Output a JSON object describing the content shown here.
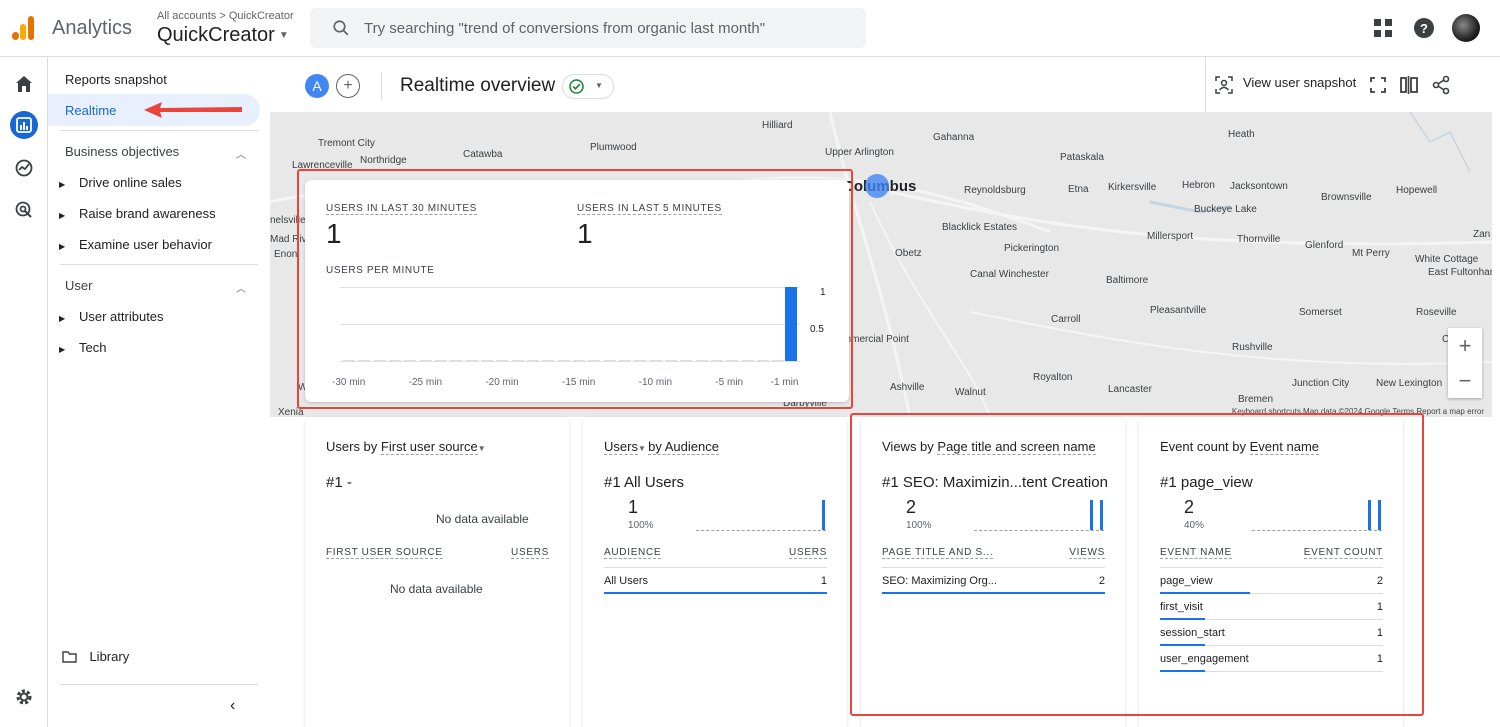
{
  "app": {
    "name": "Analytics",
    "crumb": "All accounts > QuickCreator",
    "property": "QuickCreator"
  },
  "search": {
    "placeholder": "Try searching \"trend of conversions from organic last month\""
  },
  "nav": {
    "reports_snapshot": "Reports snapshot",
    "realtime": "Realtime",
    "business_objectives": "Business objectives",
    "bo_items": [
      "Drive online sales",
      "Raise brand awareness",
      "Examine user behavior"
    ],
    "user_section": "User",
    "user_items": [
      "User attributes",
      "Tech"
    ],
    "library": "Library"
  },
  "header": {
    "comparison_badge": "A",
    "title": "Realtime overview",
    "view_snapshot": "View user snapshot"
  },
  "map": {
    "cities": [
      "Hilliard",
      "Gahanna",
      "Heath",
      "Tremont City",
      "Catawba",
      "Plumwood",
      "Upper Arlington",
      "Pataskala",
      "Lawrenceville",
      "Northridge",
      "Columbus",
      "Reynoldsburg",
      "Etna",
      "Kirkersville",
      "Hebron",
      "Jacksontown",
      "Hopewell",
      "Brownsville",
      "Buckeye Lake",
      "Blacklick Estates",
      "Obetz",
      "Pickerington",
      "Millersport",
      "Thornville",
      "Glenford",
      "Mt Perry",
      "White Cottage",
      "East Fultonham",
      "Zan",
      "Canal Winchester",
      "Baltimore",
      "Carroll",
      "Pleasantville",
      "Somerset",
      "Roseville",
      "Rushville",
      "Croo",
      "Ashville",
      "Walnut",
      "Royalton",
      "Lancaster",
      "Junction City",
      "New Lexington",
      "Bremen",
      "Xenia",
      "Darbyville",
      "Mad River",
      "Enon",
      "Commercial Point",
      "Wilberforce",
      "nelsville"
    ],
    "footer": "Keyboard shortcuts   Map data ©2024 Google   Terms   Report a map error"
  },
  "realtime_card": {
    "users_30_label": "USERS IN LAST 30 MINUTES",
    "users_30_value": "1",
    "users_5_label": "USERS IN LAST 5 MINUTES",
    "users_5_value": "1",
    "per_minute_label": "USERS PER MINUTE",
    "y_ticks": [
      "1",
      "0.5"
    ],
    "x_ticks": [
      "-30 min",
      "-25 min",
      "-20 min",
      "-15 min",
      "-10 min",
      "-5 min",
      "-1 min"
    ]
  },
  "chart_data": {
    "type": "bar",
    "title": "USERS PER MINUTE",
    "x": [
      "-30 min",
      "-25 min",
      "-20 min",
      "-15 min",
      "-10 min",
      "-5 min",
      "-1 min"
    ],
    "values": [
      0,
      0,
      0,
      0,
      0,
      0,
      1
    ],
    "ylim": [
      0,
      1
    ],
    "grid": true
  },
  "cards": [
    {
      "title_prefix": "Users by ",
      "title_dim": "First user source",
      "rank": "#1  -",
      "nodata_top": "No data available",
      "col1": "FIRST USER SOURCE",
      "col2": "USERS",
      "nodata_bottom": "No data available"
    },
    {
      "title_prefix": "Users",
      "title_dim": "by Audience",
      "rank": "#1  All Users",
      "value": "1",
      "pct": "100%",
      "col1": "AUDIENCE",
      "col2": "USERS",
      "rows": [
        {
          "label": "All Users",
          "value": "1"
        }
      ]
    },
    {
      "title_prefix": "Views by ",
      "title_dim": "Page title and screen name",
      "rank": "#1  SEO: Maximizin...tent Creation",
      "value": "2",
      "pct": "100%",
      "col1": "PAGE TITLE AND S...",
      "col2": "VIEWS",
      "rows": [
        {
          "label": "SEO: Maximizing Org...",
          "value": "2"
        }
      ]
    },
    {
      "title_prefix": "Event count by ",
      "title_dim": "Event name",
      "rank": "#1  page_view",
      "value": "2",
      "pct": "40%",
      "col1": "EVENT NAME",
      "col2": "EVENT COUNT",
      "rows": [
        {
          "label": "page_view",
          "value": "2"
        },
        {
          "label": "first_visit",
          "value": "1"
        },
        {
          "label": "session_start",
          "value": "1"
        },
        {
          "label": "user_engagement",
          "value": "1"
        }
      ]
    }
  ],
  "colors": {
    "accent": "#1a73e8",
    "highlight": "#e8453c",
    "nav_active_bg": "#e8f0fe"
  }
}
